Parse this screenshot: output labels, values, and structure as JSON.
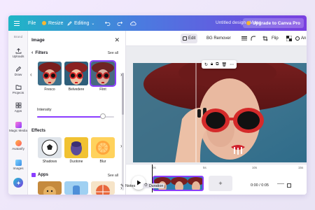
{
  "topbar": {
    "file_label": "File",
    "resize_label": "Resize",
    "editing_label": "Editing",
    "doc_title": "Untitled design - Video",
    "upgrade_label": "Upgrade to Canva Pro"
  },
  "rail": {
    "items": [
      {
        "label": "Brand",
        "icon": "brand-icon"
      },
      {
        "label": "Uploads",
        "icon": "upload-icon"
      },
      {
        "label": "Draw",
        "icon": "draw-icon"
      },
      {
        "label": "Projects",
        "icon": "folder-icon"
      },
      {
        "label": "Apps",
        "icon": "apps-icon"
      },
      {
        "label": "Magic Media",
        "icon": "magic-media-icon"
      },
      {
        "label": "Avatarify",
        "icon": "avatar-icon"
      },
      {
        "label": "Images",
        "icon": "images-icon"
      }
    ]
  },
  "panel": {
    "title": "Image",
    "filters": {
      "heading": "Filters",
      "see_all": "See all",
      "items": [
        {
          "label": "Fresco"
        },
        {
          "label": "Belvedere"
        },
        {
          "label": "Flint",
          "selected": true
        }
      ]
    },
    "intensity": {
      "label": "Intensity",
      "value": 0.85
    },
    "effects": {
      "heading": "Effects",
      "items": [
        {
          "label": "Shadows"
        },
        {
          "label": "Duotone"
        },
        {
          "label": "Blur"
        }
      ]
    },
    "apps": {
      "heading": "Apps",
      "see_all": "See all"
    }
  },
  "toolbar": {
    "edit_label": "Edit",
    "bg_remover_label": "BG Remover",
    "flip_label": "Flip",
    "more_label": "An"
  },
  "timeline": {
    "ticks": [
      "0s",
      "5s",
      "10s",
      "15s"
    ],
    "clip_duration": "5.0s"
  },
  "statusbar": {
    "notes_label": "Notes",
    "duration_label": "Duration",
    "time": "0:00 / 0:05"
  },
  "colors": {
    "accent": "#8b3dff",
    "gradient_start": "#1fb6c6",
    "gradient_end": "#7a3fe0"
  }
}
